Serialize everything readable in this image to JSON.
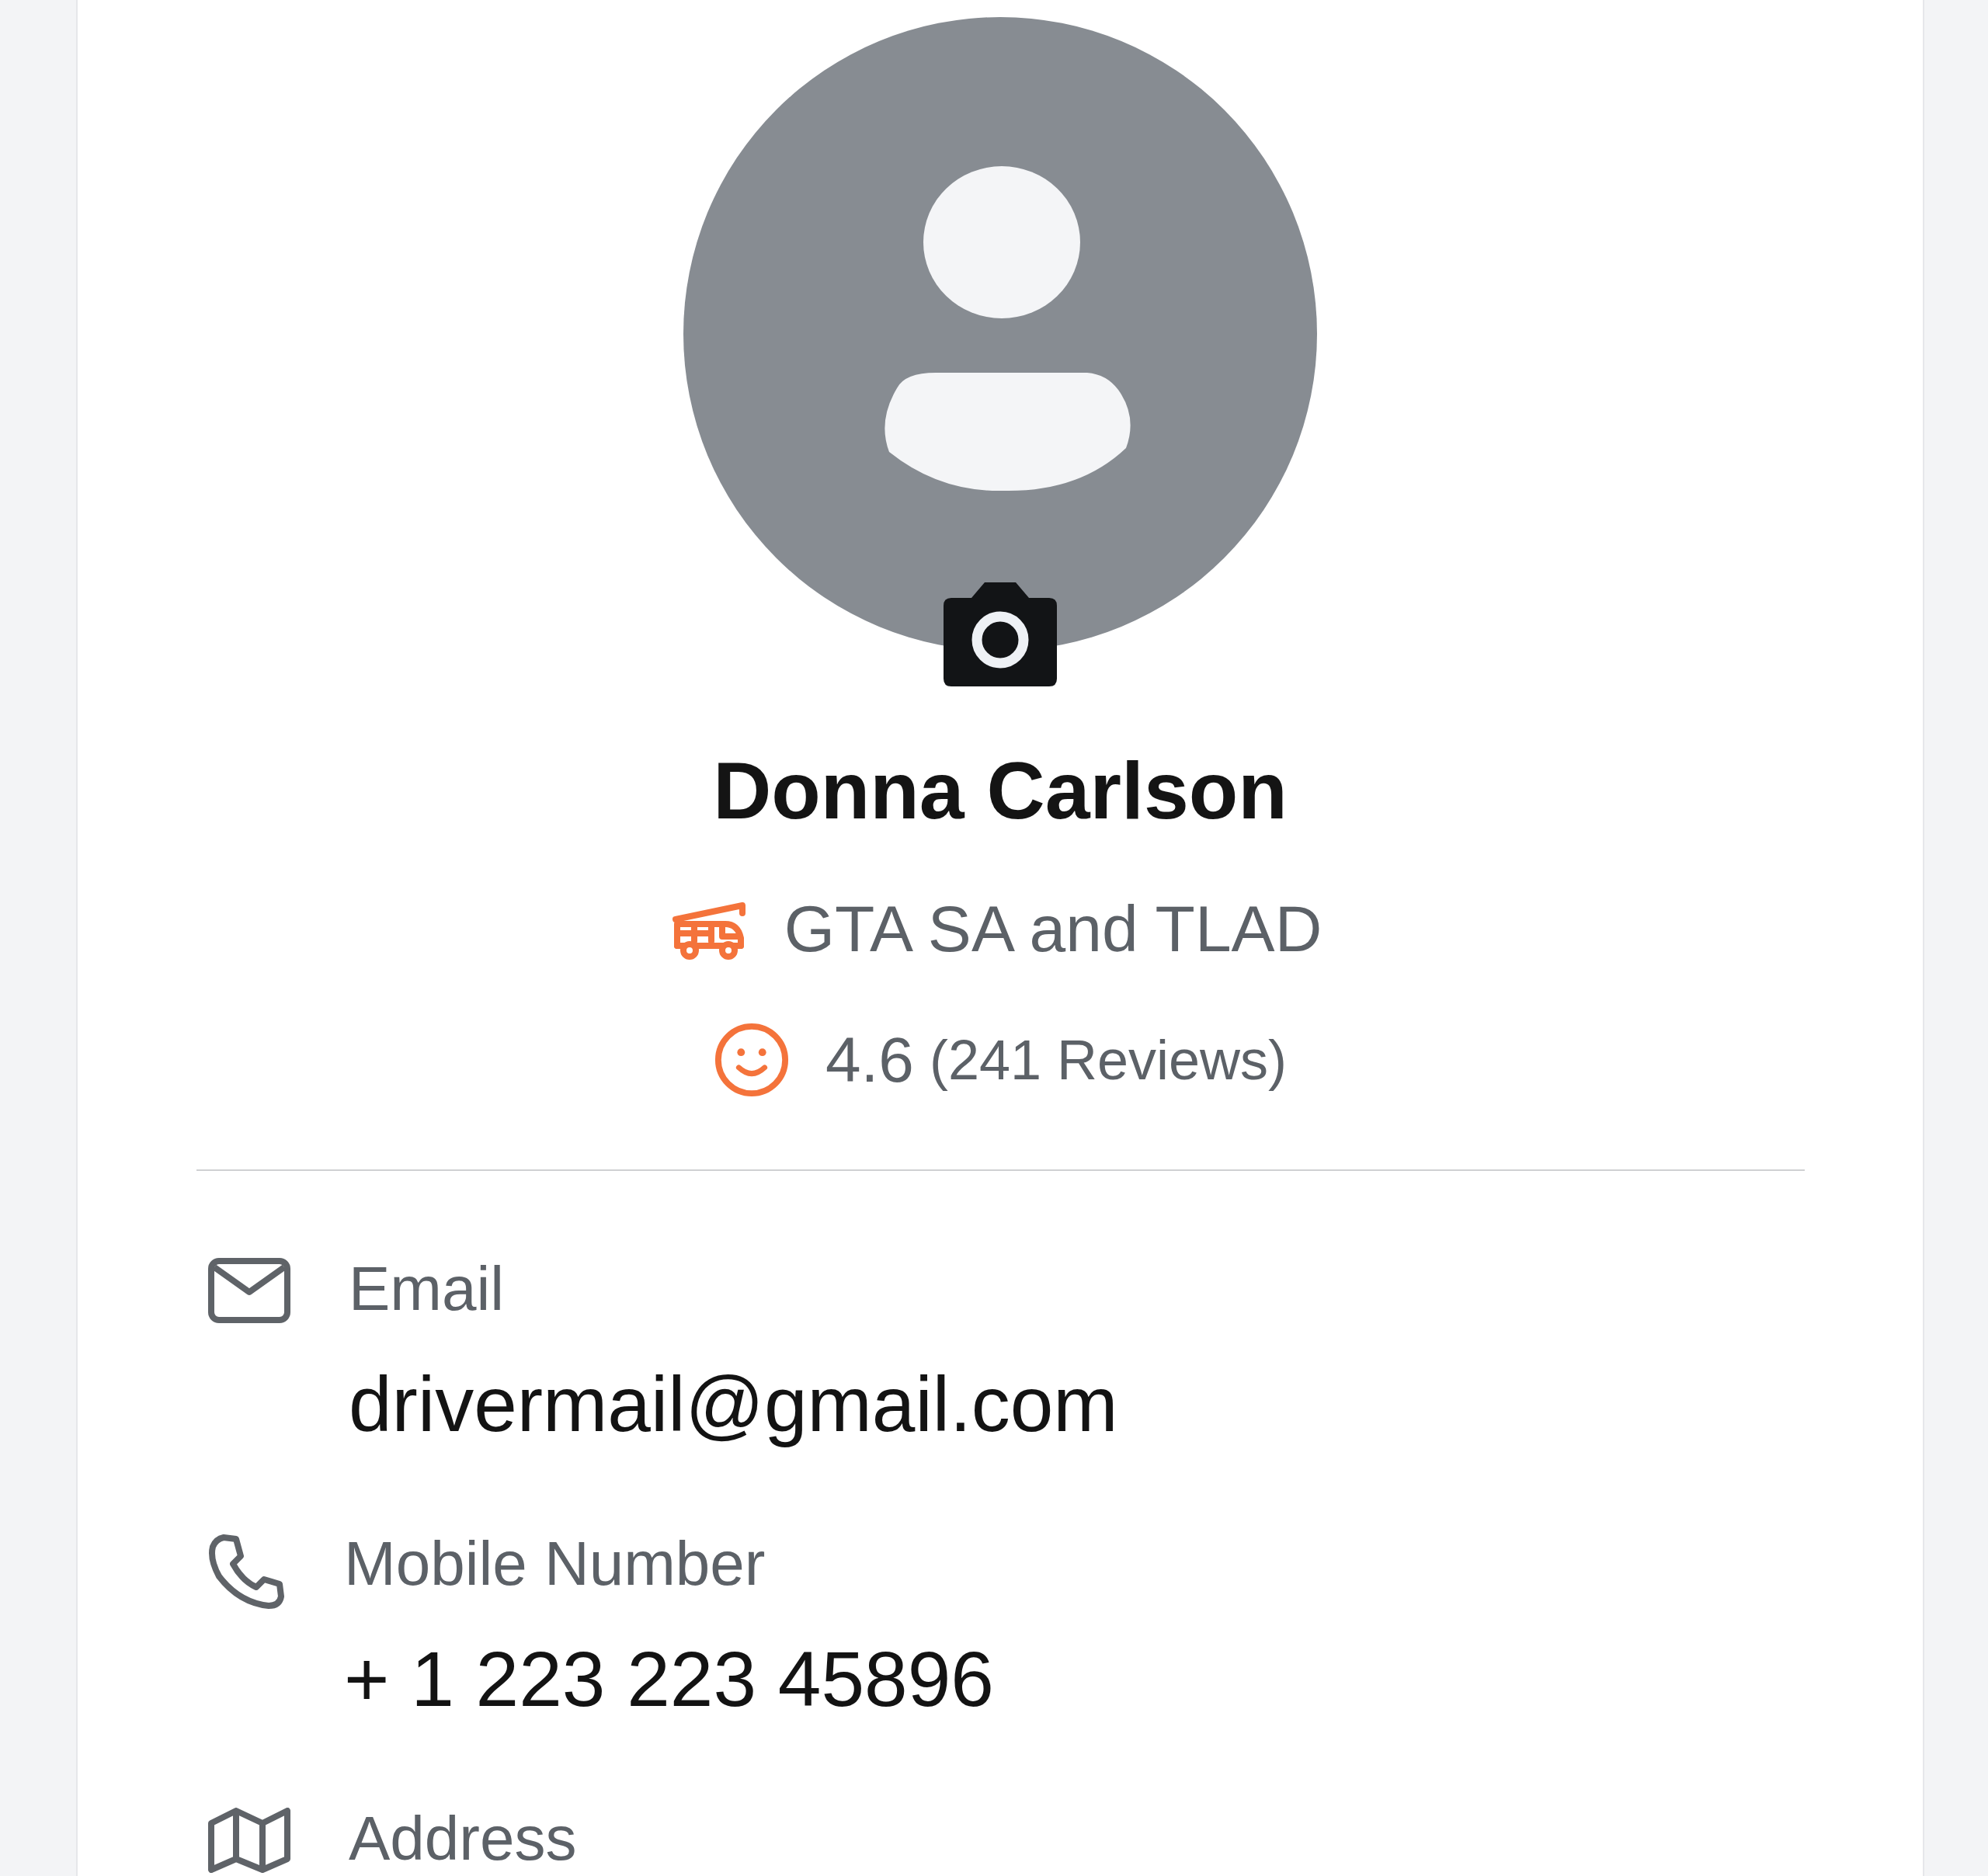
{
  "profile": {
    "name": "Donna Carlson",
    "company": "GTA SA and TLAD",
    "rating": "4.6",
    "reviews": "(241 Reviews)"
  },
  "details": [
    {
      "kind": "email",
      "label": "Email",
      "value": "drivermail@gmail.com"
    },
    {
      "kind": "phone",
      "label": "Mobile Number",
      "value": "+ 1 223 223 45896"
    },
    {
      "kind": "map",
      "label": "Address"
    }
  ]
}
